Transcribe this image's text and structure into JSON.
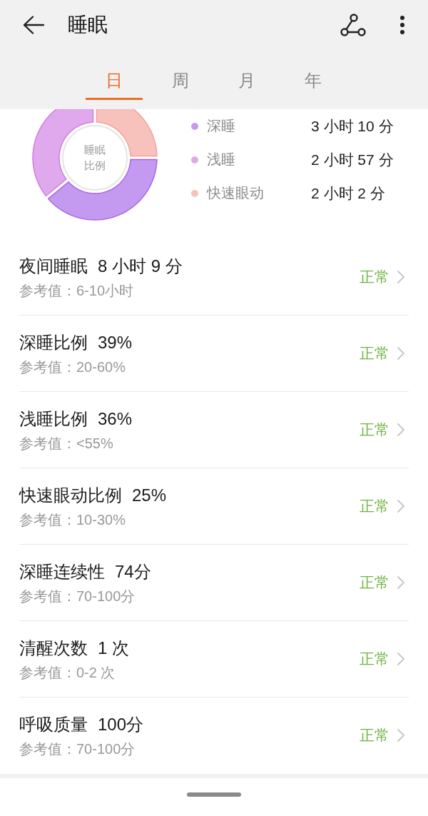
{
  "header": {
    "title": "睡眠"
  },
  "tabs": [
    {
      "label": "日",
      "selected": true
    },
    {
      "label": "周",
      "selected": false
    },
    {
      "label": "月",
      "selected": false
    },
    {
      "label": "年",
      "selected": false
    }
  ],
  "sleep_summary": {
    "chart_data": {
      "type": "donut",
      "title": "睡眠比例",
      "categories": [
        "深睡",
        "浅睡",
        "快速眼动"
      ],
      "values": [
        39,
        36,
        25
      ],
      "colors": [
        "#c49af0",
        "#e0a8ed",
        "#f7c1bc"
      ],
      "legend": "right"
    },
    "durations": [
      "3 小时 10 分",
      "2 小时 57 分",
      "2 小时 2 分"
    ]
  },
  "metrics": [
    {
      "label": "夜间睡眠",
      "value": "8 小时 9 分",
      "reference": "参考值：6-10小时",
      "status": "正常"
    },
    {
      "label": "深睡比例",
      "value": "39%",
      "reference": "参考值：20-60%",
      "status": "正常"
    },
    {
      "label": "浅睡比例",
      "value": "36%",
      "reference": "参考值：<55%",
      "status": "正常"
    },
    {
      "label": "快速眼动比例",
      "value": "25%",
      "reference": "参考值：10-30%",
      "status": "正常"
    },
    {
      "label": "深睡连续性",
      "value": "74分",
      "reference": "参考值：70-100分",
      "status": "正常"
    },
    {
      "label": "清醒次数",
      "value": "1 次",
      "reference": "参考值：0-2 次",
      "status": "正常"
    },
    {
      "label": "呼吸质量",
      "value": "100分",
      "reference": "参考值：70-100分",
      "status": "正常"
    }
  ]
}
